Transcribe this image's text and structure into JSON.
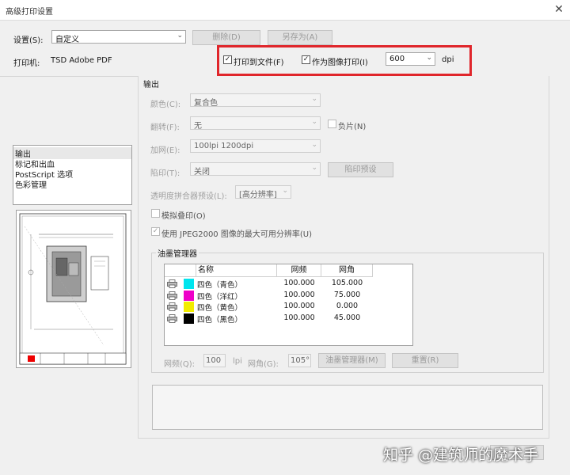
{
  "window": {
    "title": "高级打印设置",
    "close_symbol": "✕"
  },
  "settings": {
    "label": "设置(S):",
    "value": "自定义",
    "delete_label": "删除(D)",
    "save_as_label": "另存为(A)"
  },
  "printer": {
    "label": "打印机:",
    "value": "TSD Adobe PDF"
  },
  "print_to_file": {
    "label": "打印到文件(F)",
    "checked": true
  },
  "print_as_image": {
    "label": "作为图像打印(I)",
    "checked": true
  },
  "dpi": {
    "value": "600",
    "unit": "dpi"
  },
  "sidebar": {
    "items": [
      "输出",
      "标记和出血",
      "PostScript 选项",
      "色彩管理"
    ],
    "selected": 0
  },
  "output": {
    "section_title": "输出",
    "color_label": "颜色(C):",
    "color_value": "复合色",
    "flip_label": "翻转(F):",
    "flip_value": "无",
    "negative_label": "负片(N)",
    "screening_label": "加网(E):",
    "screening_value": "100lpi 1200dpi",
    "trap_label": "陷印(T):",
    "trap_value": "关闭",
    "trap_preset_label": "陷印预设",
    "flattener_label": "透明度拼合器预设(L):",
    "flattener_value": "[高分辨率]",
    "simulate_overprint_label": "模拟叠印(O)",
    "jpeg2000_label": "使用 JPEG2000 图像的最大可用分辨率(U)"
  },
  "ink_manager": {
    "title": "油墨管理器",
    "columns": [
      "名称",
      "网频",
      "网角"
    ],
    "rows": [
      {
        "name": "四色（青色）",
        "freq": "100.000",
        "angle": "105.000",
        "color": "#00e5ee"
      },
      {
        "name": "四色（洋红）",
        "freq": "100.000",
        "angle": "75.000",
        "color": "#ee00c8"
      },
      {
        "name": "四色（黄色）",
        "freq": "100.000",
        "angle": "0.000",
        "color": "#f2ec00"
      },
      {
        "name": "四色（黑色）",
        "freq": "100.000",
        "angle": "45.000",
        "color": "#000000"
      }
    ],
    "freq_label": "网频(Q):",
    "freq_value": "100",
    "freq_unit": "lpi",
    "angle_label": "网角(G):",
    "angle_value": "105°",
    "manager_button": "油墨管理器(M)",
    "reset_button": "重置(R)"
  },
  "watermark": "知乎 @建筑师的魔术手",
  "colors": {
    "highlight_box": "#e0262b",
    "background": "#f0f0f0"
  }
}
